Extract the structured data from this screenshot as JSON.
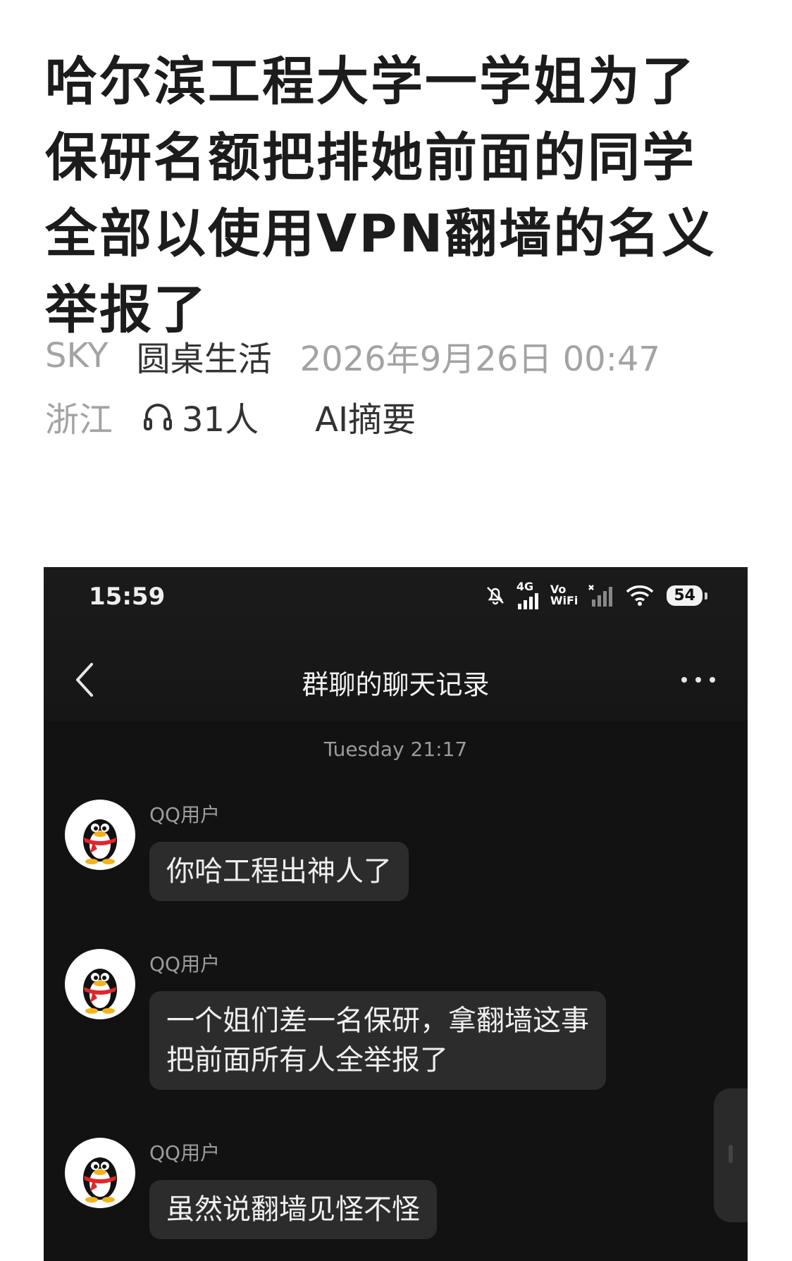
{
  "article": {
    "title": "哈尔滨工程大学一学姐为了保研名额把排她前面的同学全部以使用VPN翻墙的名义举报了",
    "author": "SKY",
    "source": "圆桌生活",
    "datetime": "2026年9月26日 00:47",
    "location": "浙江",
    "listeners": "31人",
    "ai_summary": "AI摘要"
  },
  "phone": {
    "status_time": "15:59",
    "network_label": "4G",
    "vowifi_top": "Vo",
    "vowifi_bottom": "WiFi",
    "battery": "54",
    "nav_title": "群聊的聊天记录",
    "timestamp": "Tuesday 21:17",
    "messages": [
      {
        "sender": "QQ用户",
        "text": "你哈工程出神人了"
      },
      {
        "sender": "QQ用户",
        "text": "一个姐们差一名保研，拿翻墙这事\n把前面所有人全举报了"
      },
      {
        "sender": "QQ用户",
        "text": "虽然说翻墙见怪不怪"
      }
    ]
  },
  "icons": {
    "headphone": "headphone-icon",
    "back": "chevron-left-icon",
    "more": "more-dots-icon",
    "mute": "bell-off-icon",
    "signal": "signal-bars-icon",
    "wifi": "wifi-icon",
    "avatar": "qq-penguin-avatar"
  }
}
